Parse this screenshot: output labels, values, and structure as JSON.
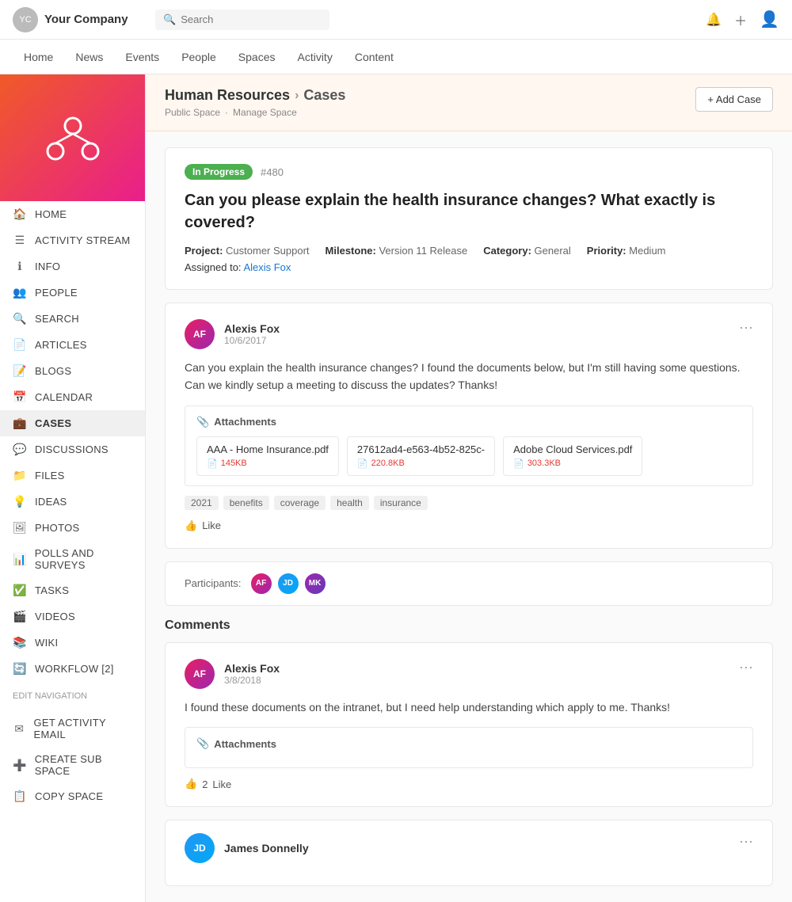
{
  "brand": {
    "name": "Your Company"
  },
  "search": {
    "placeholder": "Search"
  },
  "main_nav": {
    "items": [
      "Home",
      "News",
      "Events",
      "People",
      "Spaces",
      "Activity",
      "Content"
    ]
  },
  "sidebar": {
    "space_title": "Human Resources",
    "items": [
      {
        "id": "home",
        "label": "HOME",
        "icon": "🏠"
      },
      {
        "id": "activity",
        "label": "ACTIVITY STREAM",
        "icon": "☰"
      },
      {
        "id": "info",
        "label": "INFO",
        "icon": "ℹ"
      },
      {
        "id": "people",
        "label": "PEOPLE",
        "icon": "👥"
      },
      {
        "id": "search",
        "label": "SEARCH",
        "icon": "🔍"
      },
      {
        "id": "articles",
        "label": "ARTICLES",
        "icon": "📄"
      },
      {
        "id": "blogs",
        "label": "BLOGS",
        "icon": "📝"
      },
      {
        "id": "calendar",
        "label": "CALENDAR",
        "icon": "📅"
      },
      {
        "id": "cases",
        "label": "CASES",
        "icon": "💼"
      },
      {
        "id": "discussions",
        "label": "DISCUSSIONS",
        "icon": "💬"
      },
      {
        "id": "files",
        "label": "FILES",
        "icon": "📁"
      },
      {
        "id": "ideas",
        "label": "IDEAS",
        "icon": "💡"
      },
      {
        "id": "photos",
        "label": "PHOTOS",
        "icon": "🖼"
      },
      {
        "id": "polls",
        "label": "POLLS AND SURVEYS",
        "icon": "📊"
      },
      {
        "id": "tasks",
        "label": "TASKS",
        "icon": "✅"
      },
      {
        "id": "videos",
        "label": "VIDEOS",
        "icon": "🎬"
      },
      {
        "id": "wiki",
        "label": "WIKI",
        "icon": "📚"
      },
      {
        "id": "workflow",
        "label": "WORKFLOW [2]",
        "icon": "🔄"
      }
    ],
    "edit_nav_label": "Edit Navigation",
    "edit_items": [
      {
        "id": "activity-email",
        "label": "GET ACTIVITY EMAIL",
        "icon": "✉"
      },
      {
        "id": "create-sub",
        "label": "CREATE SUB SPACE",
        "icon": "➕"
      },
      {
        "id": "copy-space",
        "label": "COPY SPACE",
        "icon": "📋"
      }
    ]
  },
  "breadcrumb": {
    "space": "Human Resources",
    "section": "Cases",
    "separator": "›",
    "meta_public": "Public Space",
    "meta_manage": "Manage Space",
    "meta_sep": "·"
  },
  "add_case_btn": "+ Add Case",
  "case": {
    "status": "In Progress",
    "id": "#480",
    "title": "Can you please explain the health insurance changes? What exactly is covered?",
    "project_label": "Project:",
    "project_value": "Customer Support",
    "milestone_label": "Milestone:",
    "milestone_value": "Version 11 Release",
    "category_label": "Category:",
    "category_value": "General",
    "priority_label": "Priority:",
    "priority_value": "Medium",
    "assigned_label": "Assigned to:",
    "assigned_value": "Alexis Fox"
  },
  "main_comment": {
    "author": "Alexis Fox",
    "date": "10/6/2017",
    "body": "Can you explain the health insurance changes? I found the documents below, but I'm still having some questions. Can we kindly setup a meeting to discuss the updates? Thanks!",
    "attachments_label": "Attachments",
    "attachments": [
      {
        "name": "AAA - Home Insurance.pdf",
        "size": "145KB"
      },
      {
        "name": "27612ad4-e563-4b52-825c-",
        "size": "220.8KB"
      },
      {
        "name": "Adobe Cloud Services.pdf",
        "size": "303.3KB"
      }
    ],
    "tags": [
      "2021",
      "benefits",
      "coverage",
      "health",
      "insurance"
    ],
    "like_label": "Like"
  },
  "participants": {
    "label": "Participants:",
    "avatars": [
      "AF",
      "JD",
      "MK"
    ]
  },
  "comments_section": {
    "title": "Comments",
    "comments": [
      {
        "author": "Alexis Fox",
        "date": "3/8/2018",
        "body": "I found these documents on the intranet, but I need help understanding which apply to me. Thanks!",
        "attachments_label": "Attachments",
        "like_count": "2",
        "like_label": "Like"
      }
    ]
  },
  "james_comment": {
    "author": "James Donnelly"
  }
}
